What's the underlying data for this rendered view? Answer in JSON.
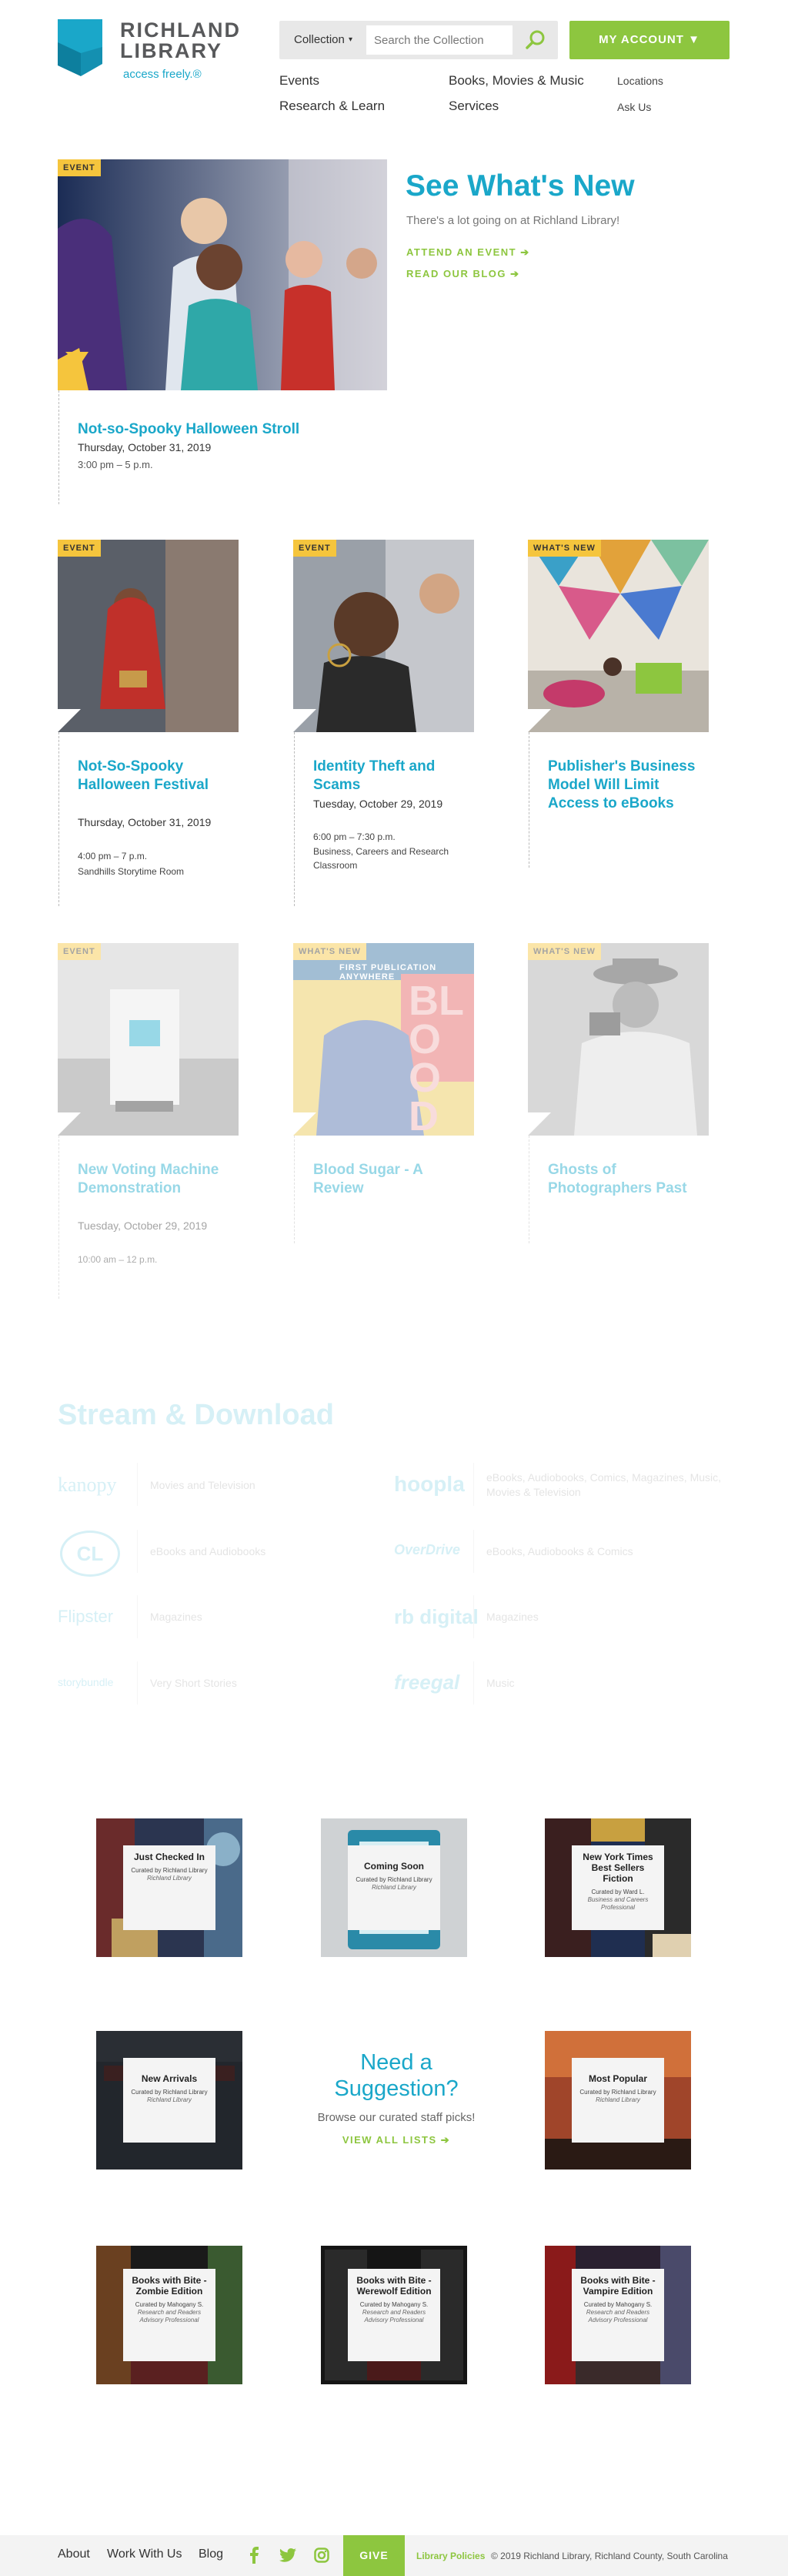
{
  "header": {
    "logo_line1": "RICHLAND",
    "logo_line2": "LIBRARY",
    "logo_tagline": "access freely.®",
    "search_select": "Collection",
    "search_placeholder": "Search the Collection",
    "account_label": "MY ACCOUNT ▼",
    "nav": {
      "events": "Events",
      "books": "Books, Movies & Music",
      "locations": "Locations",
      "research": "Research & Learn",
      "services": "Services",
      "ask": "Ask Us"
    }
  },
  "hero": {
    "badge": "EVENT",
    "title": "Not-so-Spooky Halloween Stroll",
    "date": "Thursday, October 31, 2019",
    "time": "3:00 pm – 5 p.m.",
    "heading": "See What's New",
    "subheading": "There's a lot going on at Richland Library!",
    "cta1": "ATTEND AN EVENT ➔",
    "cta2": "READ OUR BLOG ➔"
  },
  "cards": [
    {
      "badge": "EVENT",
      "title": "Not-So-Spooky Halloween Festival",
      "date": "Thursday, October 31, 2019",
      "time": "4:00 pm – 7 p.m.",
      "location": "Sandhills Storytime Room"
    },
    {
      "badge": "EVENT",
      "title": "Identity Theft and Scams",
      "date": "Tuesday, October 29, 2019",
      "time": "6:00 pm – 7:30 p.m.",
      "location": "Business, Careers and Research Classroom"
    },
    {
      "badge": "WHAT'S NEW",
      "title": "Publisher's Business Model Will Limit Access to eBooks",
      "date": "",
      "time": "",
      "location": ""
    },
    {
      "badge": "EVENT",
      "title": "New Voting Machine Demonstration",
      "date": "Tuesday, October 29, 2019",
      "time": "10:00 am – 12 p.m.",
      "location": ""
    },
    {
      "badge": "WHAT'S NEW",
      "title": "Blood Sugar - A Review",
      "date": "",
      "time": "",
      "location": ""
    },
    {
      "badge": "WHAT'S NEW",
      "title": "Ghosts of Photographers Past",
      "date": "",
      "time": "",
      "location": ""
    }
  ],
  "cover_text": {
    "blood_top": "FIRST PUBLICATION ANYWHERE",
    "blood_big": "BLOOD SUG"
  },
  "stream": {
    "heading": "Stream & Download",
    "items": [
      {
        "logo": "kanopy",
        "desc": "Movies and Television"
      },
      {
        "logo": "hoopla",
        "desc": "eBooks, Audiobooks, Comics, Magazines, Music, Movies & Television"
      },
      {
        "logo": "CL",
        "desc": "eBooks and Audiobooks"
      },
      {
        "logo": "OverDrive",
        "desc": "eBooks, Audiobooks & Comics"
      },
      {
        "logo": "Flipster",
        "desc": "Magazines"
      },
      {
        "logo": "rb digital",
        "desc": "Magazines"
      },
      {
        "logo": "storybundle",
        "desc": "Very Short Stories"
      },
      {
        "logo": "freegal",
        "desc": "Music"
      }
    ]
  },
  "lists": [
    {
      "title": "Just Checked In",
      "curator": "Curated by Richland Library",
      "role": "Richland Library"
    },
    {
      "title": "Coming Soon",
      "curator": "Curated by Richland Library",
      "role": "Richland Library"
    },
    {
      "title": "New York Times Best Sellers Fiction",
      "curator": "Curated by Ward L.",
      "role": "Business and Careers Professional"
    },
    {
      "title": "New Arrivals",
      "curator": "Curated by Richland Library",
      "role": "Richland Library"
    },
    {
      "title": "Most Popular",
      "curator": "Curated by Richland Library",
      "role": "Richland Library"
    },
    {
      "title": "Books with Bite - Zombie Edition",
      "curator": "Curated by Mahogany S.",
      "role": "Research and Readers Advisory Professional"
    },
    {
      "title": "Books with Bite - Werewolf Edition",
      "curator": "Curated by Mahogany S.",
      "role": "Research and Readers Advisory Professional"
    },
    {
      "title": "Books with Bite - Vampire Edition",
      "curator": "Curated by Mahogany S.",
      "role": "Research and Readers Advisory Professional"
    }
  ],
  "suggestion": {
    "heading": "Need a Suggestion?",
    "sub": "Browse our curated staff picks!",
    "link": "VIEW ALL LISTS ➔"
  },
  "footer": {
    "about": "About",
    "work": "Work With Us",
    "blog": "Blog",
    "give": "GIVE",
    "policies": "Library Policies",
    "copyright": "© 2019 Richland Library, Richland County, South Carolina"
  },
  "colors": {
    "brand": "#1aa7c9",
    "accent": "#8dc63f",
    "badge": "#f5c53d"
  }
}
